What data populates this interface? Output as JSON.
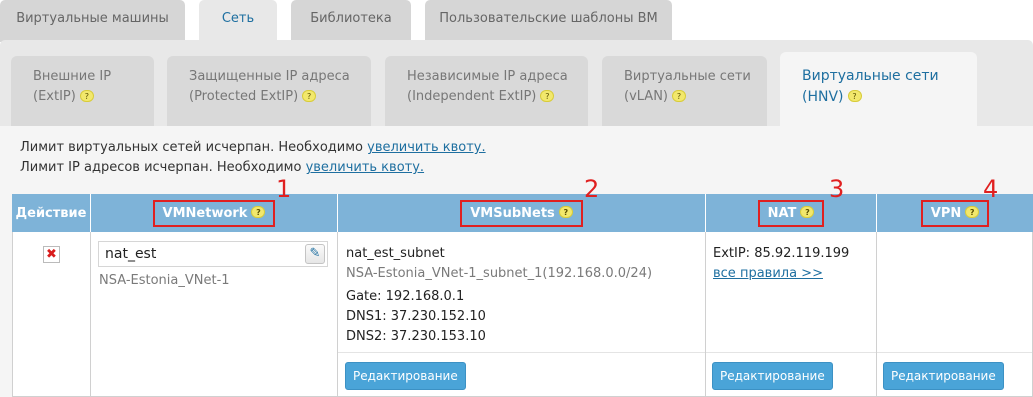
{
  "top_tabs": [
    "Виртуальные машины",
    "Сеть",
    "Библиотека",
    "Пользовательские шаблоны ВМ"
  ],
  "sub_tabs": [
    {
      "line1": "Внешние IP",
      "line2": "(ExtIP)"
    },
    {
      "line1": "Защищенные IP адреса",
      "line2": "(Protected ExtIP)"
    },
    {
      "line1": "Независимые IP адреса",
      "line2": "(Independent ExtIP)"
    },
    {
      "line1": "Виртуальные сети",
      "line2": "(vLAN)"
    },
    {
      "line1": "Виртуальные сети",
      "line2": "(HNV)"
    }
  ],
  "help_glyph": "?",
  "notices": [
    {
      "text": "Лимит виртуальных сетей исчерпан. Необходимо ",
      "link": "увеличить квоту."
    },
    {
      "text": "Лимит IP адресов исчерпан. Необходимо ",
      "link": "увеличить квоту."
    }
  ],
  "table": {
    "headers": [
      "Действие",
      "VMNetwork",
      "VMSubNets",
      "NAT",
      "VPN"
    ],
    "callouts": [
      "1",
      "2",
      "3",
      "4"
    ],
    "row": {
      "delete_glyph": "✖",
      "network_name": "nat_est",
      "network_sub": "NSA-Estonia_VNet-1",
      "subnet_name": "nat_est_subnet",
      "subnet_sub": "NSA-Estonia_VNet-1_subnet_1(192.168.0.0/24)",
      "gate": "Gate: 192.168.0.1",
      "dns1": "DNS1: 37.230.152.10",
      "dns2": "DNS2: 37.230.153.10",
      "extip": "ExtIP: 85.92.119.199",
      "all_rules": "все правила >>",
      "edit_label": "Редактирование"
    }
  },
  "colors": {
    "accent": "#1e6fa0",
    "header_bg": "#7eb3d8",
    "button_bg": "#4aa4d8",
    "callout": "#e02020",
    "help_bg": "#f2e86c"
  },
  "icons": {
    "edit": "pencil-icon",
    "delete": "delete-icon",
    "help": "help-icon"
  }
}
